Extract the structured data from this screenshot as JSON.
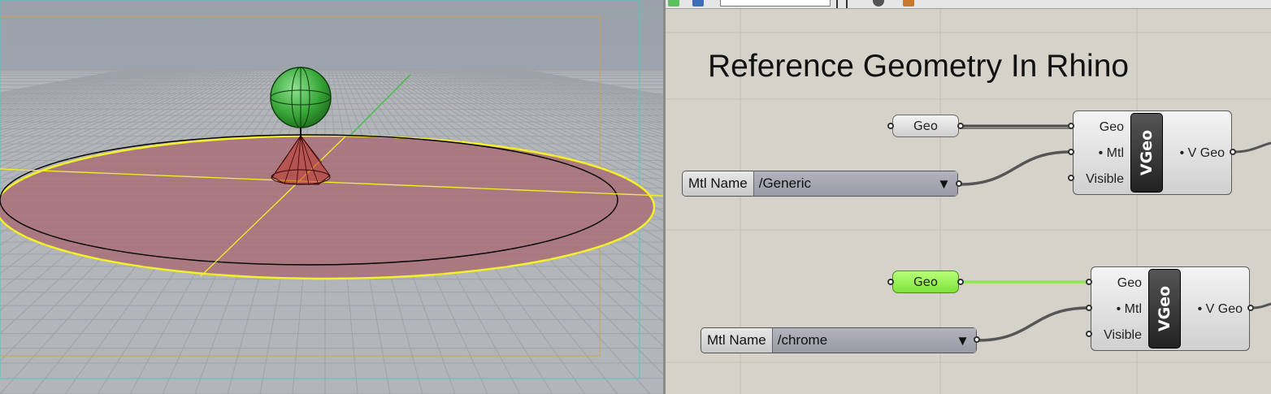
{
  "canvas": {
    "title": "Reference Geometry In Rhino"
  },
  "groups": [
    {
      "geo_param": {
        "label": "Geo",
        "active": false
      },
      "value_list": {
        "label": "Mtl Name",
        "value": "/Generic"
      },
      "component": {
        "name": "VGeo",
        "inputs": [
          "Geo",
          "• Mtl",
          "Visible"
        ],
        "output": "• V Geo"
      }
    },
    {
      "geo_param": {
        "label": "Geo",
        "active": true
      },
      "value_list": {
        "label": "Mtl Name",
        "value": "/chrome"
      },
      "component": {
        "name": "VGeo",
        "inputs": [
          "Geo",
          "• Mtl",
          "Visible"
        ],
        "output": "• V Geo"
      }
    }
  ],
  "colors": {
    "sphere": "#3aa83a",
    "disc": "#a97880",
    "selection": "#f4f02a",
    "active_param": "#8ee84a"
  },
  "icons": [
    "dropdown-triangle-icon",
    "toolbar-icon"
  ]
}
